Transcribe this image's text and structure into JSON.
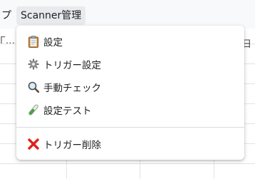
{
  "menubar": {
    "prev_item_label": "プ",
    "active_menu_label": "Scanner管理"
  },
  "sheet": {
    "left_fragment": "Г…",
    "right_fragment": "日"
  },
  "dropdown": {
    "items": [
      {
        "label": "設定",
        "icon": "clipboard-icon"
      },
      {
        "label": "トリガー設定",
        "icon": "gear-icon"
      },
      {
        "label": "手動チェック",
        "icon": "magnifying-glass-icon"
      },
      {
        "label": "設定テスト",
        "icon": "test-tube-icon"
      },
      {
        "label": "トリガー削除",
        "icon": "red-x-icon"
      }
    ]
  },
  "colors": {
    "menu_text": "#202124",
    "active_menu_bg": "#e8eaed",
    "delete_icon": "#e0201c",
    "separator": "#dadce0"
  }
}
